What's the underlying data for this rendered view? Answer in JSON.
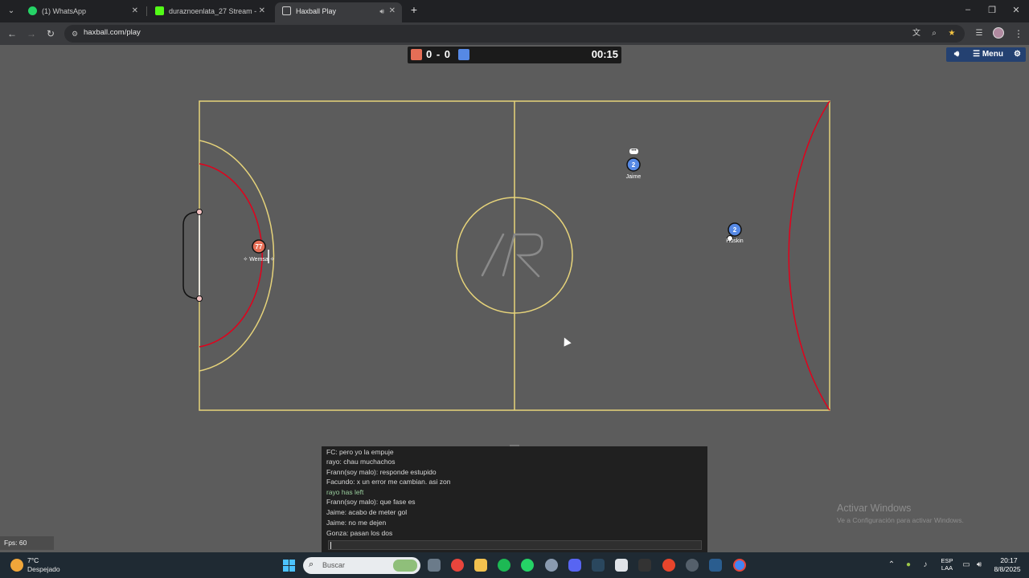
{
  "browser": {
    "tabs": [
      {
        "label": "(1) WhatsApp",
        "color": "#25d366"
      },
      {
        "label": "duraznoenlata_27 Stream - Wa…",
        "color": "#53fc18"
      },
      {
        "label": "Haxball Play",
        "color": "#cfcfcf"
      }
    ],
    "url": "haxball.com/play"
  },
  "scoreboard": {
    "score": "0 - 0",
    "time": "00:15",
    "red_color": "#e56e56",
    "blue_color": "#5689e5"
  },
  "game_menu": {
    "menu_label": "Menu"
  },
  "field": {
    "center_logo": "/R",
    "line_color": "#e6d37a",
    "arc_color": "#e3001b"
  },
  "players": {
    "red_player": {
      "number": "77",
      "name": "✧ Wemsa ✧"
    },
    "blue_player_1": {
      "number": "2",
      "name": "Jaime"
    },
    "blue_player_2": {
      "number": "2",
      "name": "Huskin"
    }
  },
  "chat": {
    "lines": [
      {
        "text": "FC: pero yo la empuje",
        "system": false
      },
      {
        "text": "rayo: chau muchachos",
        "system": false
      },
      {
        "text": "Frann(soy malo): responde estupido",
        "system": false
      },
      {
        "text": "Facundo: x un error me cambian. asi zon",
        "system": false
      },
      {
        "text": "rayo has left",
        "system": true
      },
      {
        "text": "Frann(soy malo): que fase es",
        "system": false
      },
      {
        "text": "Jaime: acabo de meter gol",
        "system": false
      },
      {
        "text": "Jaime: no me dejen",
        "system": false
      },
      {
        "text": "Gonza: pasan los dos",
        "system": false
      }
    ]
  },
  "fps": "Fps: 60",
  "watermark": {
    "title": "Activar Windows",
    "subtitle": "Ve a Configuración para activar Windows."
  },
  "taskbar": {
    "temperature": "7°C",
    "weather": "Despejado",
    "search_placeholder": "Buscar",
    "lang_1": "ESP",
    "lang_2": "LAA",
    "time": "20:17",
    "date": "8/8/2025"
  }
}
